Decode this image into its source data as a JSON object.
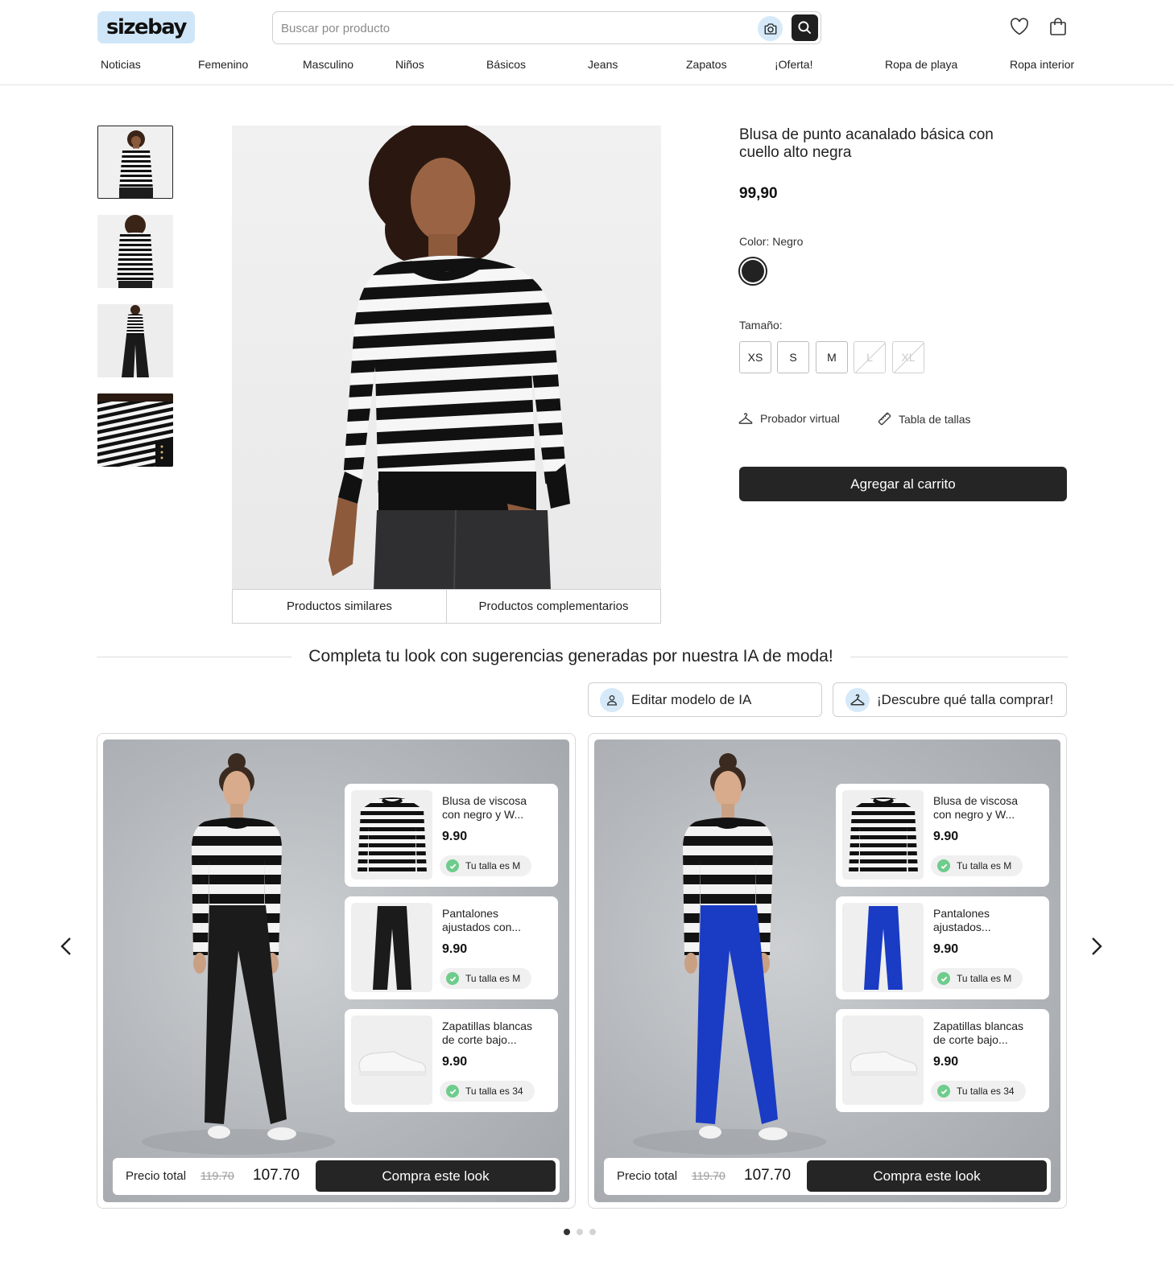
{
  "header": {
    "logo": "sizebay",
    "search_placeholder": "Buscar por producto",
    "nav": [
      "Noticias",
      "Femenino",
      "Masculino",
      "Niños",
      "Básicos",
      "Jeans",
      "Zapatos",
      "¡Oferta!",
      "Ropa de playa",
      "Ropa interior"
    ]
  },
  "gallery": {
    "tabs": [
      "Productos similares",
      "Productos complementarios"
    ]
  },
  "product": {
    "title": "Blusa de punto acanalado básica con cuello alto negra",
    "price": "99,90",
    "color_label": "Color: Negro",
    "color_hex": "#222222",
    "size_label": "Tamaño:",
    "sizes": [
      {
        "label": "XS",
        "available": true
      },
      {
        "label": "S",
        "available": true
      },
      {
        "label": "M",
        "available": true
      },
      {
        "label": "L",
        "available": false
      },
      {
        "label": "XL",
        "available": false
      }
    ],
    "virtual_fitting": "Probador virtual",
    "size_chart": "Tabla de tallas",
    "add_to_cart": "Agregar al carrito"
  },
  "ai_section": {
    "heading": "Completa tu look con sugerencias generadas por nuestra IA de moda!",
    "edit_model": "Editar modelo de IA",
    "discover_size": "¡Descubre qué talla comprar!",
    "looks": [
      {
        "pants_color": "#1b1b1b",
        "items": [
          {
            "name": "Blusa de viscosa con negro y W...",
            "price": "9.90",
            "size": "Tu talla es M"
          },
          {
            "name": "Pantalones ajustados con...",
            "price": "9.90",
            "size": "Tu talla es M"
          },
          {
            "name": "Zapatillas blancas de corte bajo...",
            "price": "9.90",
            "size": "Tu talla es 34"
          }
        ],
        "total_label": "Precio total",
        "old_total": "119.70",
        "new_total": "107.70",
        "buy_label": "Compra este look"
      },
      {
        "pants_color": "#1a3bc4",
        "items": [
          {
            "name": "Blusa de viscosa con negro y W...",
            "price": "9.90",
            "size": "Tu talla es M"
          },
          {
            "name": "Pantalones ajustados...",
            "price": "9.90",
            "size": "Tu talla es M"
          },
          {
            "name": "Zapatillas blancas de corte bajo...",
            "price": "9.90",
            "size": "Tu talla es 34"
          }
        ],
        "total_label": "Precio total",
        "old_total": "119.70",
        "new_total": "107.70",
        "buy_label": "Compra este look"
      }
    ],
    "pagination": {
      "pages": 3,
      "active": 1
    }
  }
}
